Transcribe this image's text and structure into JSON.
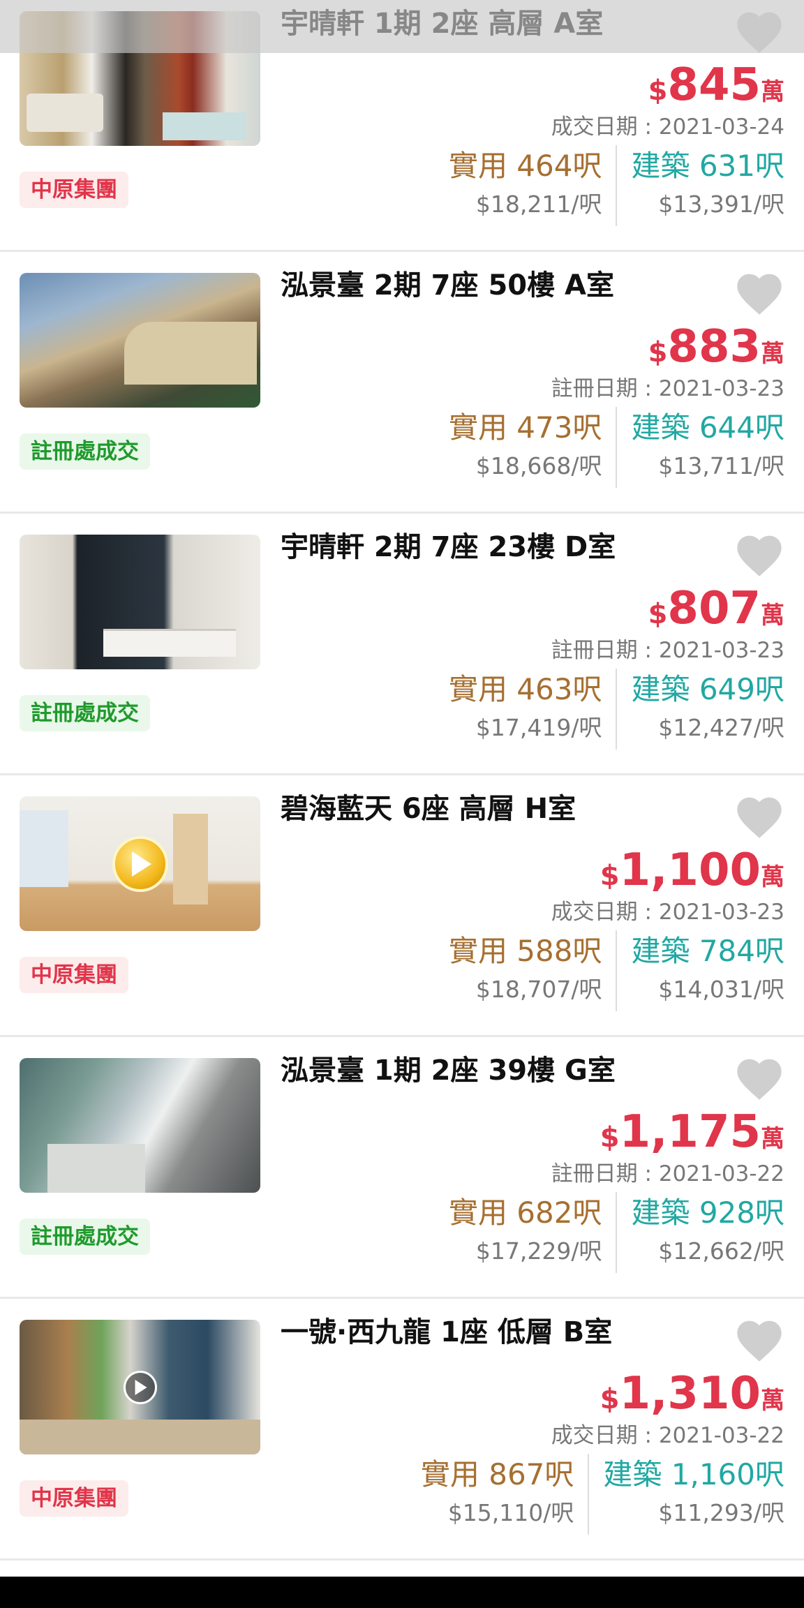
{
  "colors": {
    "price": "#e0354a",
    "saleable": "#a66f31",
    "gross": "#21a8a3",
    "centaline_badge_text": "#e0354a",
    "centaline_badge_bg": "#fdecec",
    "registry_badge_text": "#1f9a2c",
    "registry_badge_bg": "#e9f8ea",
    "heart": "#cfcfcf"
  },
  "icons": {
    "favorite": "heart-icon",
    "play": "play-icon"
  },
  "listings": [
    {
      "title": "宇晴軒 1期 2座 高層 A室",
      "source": "中原集團",
      "price_currency": "$",
      "price_value": "845",
      "price_unit": "萬",
      "date": "成交日期 : 2021-03-24",
      "saleable_area": "實用 464呎",
      "saleable_unit_price": "$18,211/呎",
      "gross_area": "建築 631呎",
      "gross_unit_price": "$13,391/呎"
    },
    {
      "title": "泓景臺 2期 7座 50樓 A室",
      "source": "註冊處成交",
      "price_currency": "$",
      "price_value": "883",
      "price_unit": "萬",
      "date": "註冊日期 : 2021-03-23",
      "saleable_area": "實用 473呎",
      "saleable_unit_price": "$18,668/呎",
      "gross_area": "建築 644呎",
      "gross_unit_price": "$13,711/呎"
    },
    {
      "title": "宇晴軒 2期 7座 23樓 D室",
      "source": "註冊處成交",
      "price_currency": "$",
      "price_value": "807",
      "price_unit": "萬",
      "date": "註冊日期 : 2021-03-23",
      "saleable_area": "實用 463呎",
      "saleable_unit_price": "$17,419/呎",
      "gross_area": "建築 649呎",
      "gross_unit_price": "$12,427/呎"
    },
    {
      "title": "碧海藍天 6座 高層 H室",
      "source": "中原集團",
      "price_currency": "$",
      "price_value": "1,100",
      "price_unit": "萬",
      "date": "成交日期 : 2021-03-23",
      "saleable_area": "實用 588呎",
      "saleable_unit_price": "$18,707/呎",
      "gross_area": "建築 784呎",
      "gross_unit_price": "$14,031/呎"
    },
    {
      "title": "泓景臺 1期 2座 39樓 G室",
      "source": "註冊處成交",
      "price_currency": "$",
      "price_value": "1,175",
      "price_unit": "萬",
      "date": "註冊日期 : 2021-03-22",
      "saleable_area": "實用 682呎",
      "saleable_unit_price": "$17,229/呎",
      "gross_area": "建築 928呎",
      "gross_unit_price": "$12,662/呎"
    },
    {
      "title": "一號·西九龍 1座 低層 B室",
      "source": "中原集團",
      "price_currency": "$",
      "price_value": "1,310",
      "price_unit": "萬",
      "date": "成交日期 : 2021-03-22",
      "saleable_area": "實用 867呎",
      "saleable_unit_price": "$15,110/呎",
      "gross_area": "建築 1,160呎",
      "gross_unit_price": "$11,293/呎"
    }
  ]
}
